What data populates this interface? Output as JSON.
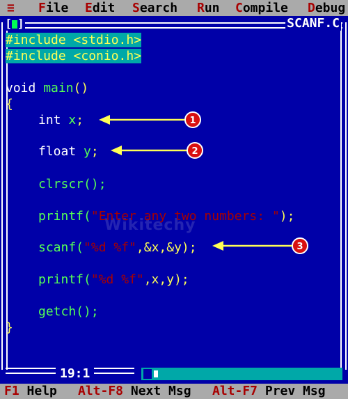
{
  "menubar": {
    "system_icon": "≡",
    "items": [
      {
        "hot": "F",
        "rest": "ile"
      },
      {
        "hot": "E",
        "rest": "dit"
      },
      {
        "hot": "S",
        "rest": "earch"
      },
      {
        "hot": "R",
        "rest": "un"
      },
      {
        "hot": "C",
        "rest": "ompile"
      },
      {
        "hot": "D",
        "rest": "ebug"
      }
    ]
  },
  "window": {
    "close_box": "[■]",
    "title": "SCANF.C",
    "cursor_position": "19:1"
  },
  "code_lines": {
    "l1": "#include <stdio.h>",
    "l2": "#include <conio.h>",
    "l3_a": "void ",
    "l3_b": "main",
    "l3_c": "()",
    "l4": "{",
    "l5_a": "int ",
    "l5_b": "x",
    "l5_c": ";",
    "l6_a": "float ",
    "l6_b": "y",
    "l6_c": ";",
    "l7": "clrscr();",
    "l8_a": "printf(",
    "l8_b": "\"Enter any two numbers: \"",
    "l8_c": ");",
    "l9_a": "scanf(",
    "l9_b": "\"%d %f\"",
    "l9_c": ",&x,&y);",
    "l10_a": "printf(",
    "l10_b": "\"%d %f\"",
    "l10_c": ",x,y);",
    "l11": "getch();",
    "l12": "}"
  },
  "annotations": [
    "1",
    "2",
    "3"
  ],
  "watermark": "Wikitechy",
  "hintbar": {
    "items": [
      {
        "key": "F1",
        "label": " Help"
      },
      {
        "key": "Alt-F8",
        "label": " Next Msg"
      },
      {
        "key": "Alt-F7",
        "label": " Prev Msg"
      }
    ]
  },
  "colors": {
    "editor_bg": "#0000a8",
    "menu_bg": "#aaaaaa",
    "hotkey": "#a80000",
    "selection_bg": "#00a8a8",
    "keyword_text": "#ffffff",
    "code_text": "#ffff55",
    "string_text": "#a80000",
    "annotation_arrow": "#ffff55",
    "badge": "#d81010"
  }
}
